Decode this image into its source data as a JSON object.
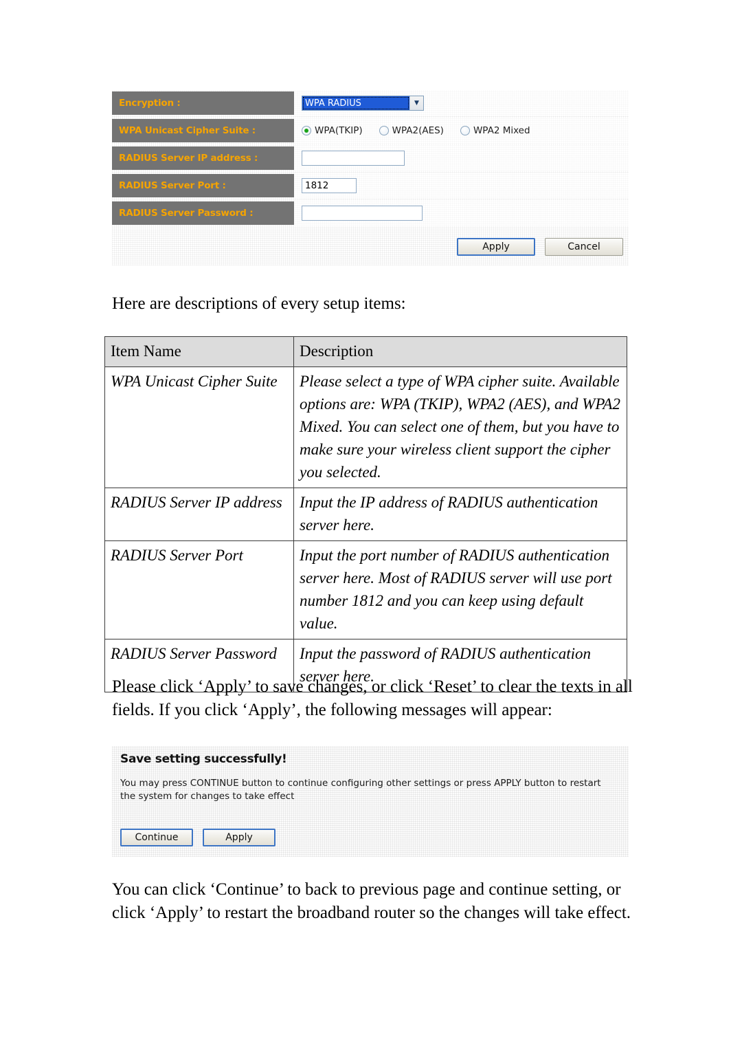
{
  "router_form": {
    "rows": [
      {
        "label": "Encryption :",
        "type": "select"
      },
      {
        "label": "WPA Unicast Cipher Suite :",
        "type": "radios"
      },
      {
        "label": "RADIUS Server IP address :",
        "type": "text",
        "value": ""
      },
      {
        "label": "RADIUS Server Port :",
        "type": "text",
        "value": "1812"
      },
      {
        "label": "RADIUS Server Password :",
        "type": "text",
        "value": ""
      }
    ],
    "encryption_select": {
      "selected": "WPA RADIUS",
      "arrow_icon": "chevron-down-icon"
    },
    "cipher_options": [
      {
        "label": "WPA(TKIP)",
        "checked": true
      },
      {
        "label": "WPA2(AES)",
        "checked": false
      },
      {
        "label": "WPA2 Mixed",
        "checked": false
      }
    ],
    "radius_ip_value": "",
    "radius_port_value": "1812",
    "radius_password_value": "",
    "buttons": {
      "apply": "Apply",
      "cancel": "Cancel"
    },
    "colors": {
      "label_bg": "#737373",
      "label_text": "#f6a400",
      "select_highlight": "#1f5bd7",
      "radio_selected": "#19a319",
      "focus_border": "#3c74c4"
    }
  },
  "document": {
    "intro_line": "Here are descriptions of every setup items:",
    "paragraph_apply": "Please click ‘Apply’ to save changes, or click ‘Reset’ to clear the texts in all fields. If you click ‘Apply’, the following messages will appear:",
    "paragraph_continue": "You can click ‘Continue’ to back to previous page and continue setting, or click ‘Apply’ to restart the broadband router so the changes will take effect."
  },
  "desc_table": {
    "headers": [
      "Item Name",
      "Description"
    ],
    "rows": [
      {
        "item": "WPA Unicast Cipher Suite",
        "description": "Please select a type of WPA cipher suite. Available options are: WPA (TKIP), WPA2 (AES), and WPA2 Mixed. You can select one of them, but you have to make sure your wireless client support the cipher you selected."
      },
      {
        "item": "RADIUS Server IP address",
        "description": "Input the IP address of RADIUS authentication server here."
      },
      {
        "item": "RADIUS Server Port",
        "description": "Input the port number of RADIUS authentication server here. Most of RADIUS server will use port number 1812 and you can keep using default value."
      },
      {
        "item": "RADIUS Server Password",
        "description": "Input the password of RADIUS authentication server here."
      }
    ]
  },
  "save_dialog": {
    "title": "Save setting successfully!",
    "body": "You may press CONTINUE button to continue configuring other settings or press APPLY button to restart the system for changes to take effect",
    "buttons": {
      "continue": "Continue",
      "apply": "Apply"
    }
  }
}
